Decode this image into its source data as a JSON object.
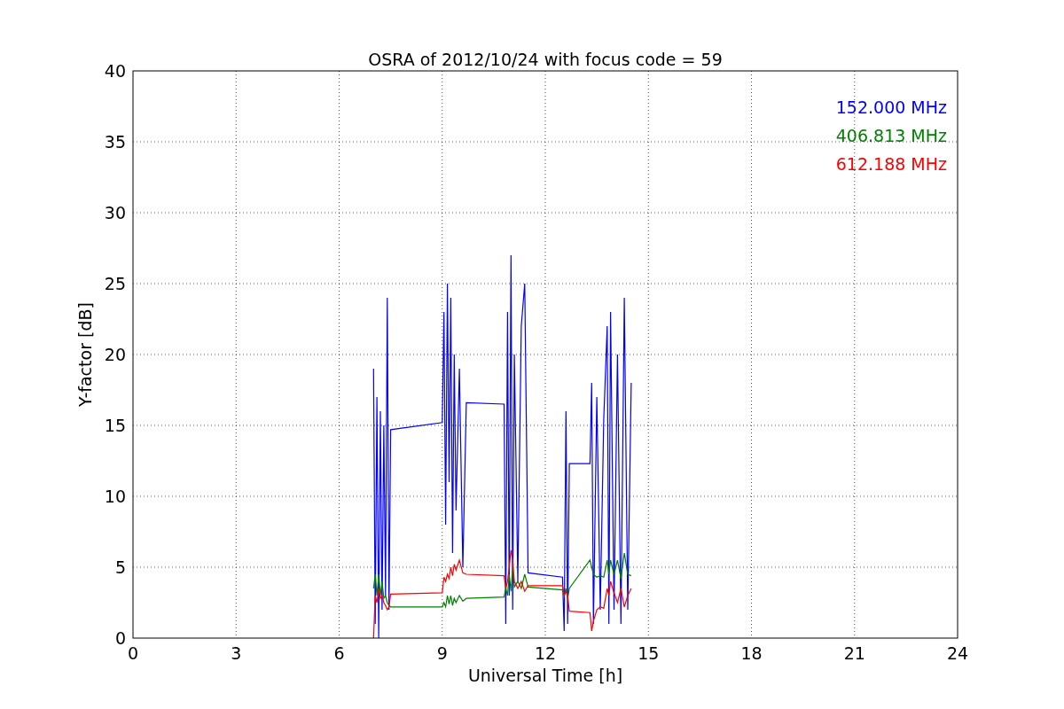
{
  "figure": {
    "chart_data": {
      "type": "line",
      "title": "OSRA of 2012/10/24 with focus code = 59",
      "xlabel": "Universal Time [h]",
      "ylabel": "Y-factor [dB]",
      "x": [
        7.0,
        7.05,
        7.1,
        7.15,
        7.2,
        7.25,
        7.3,
        7.35,
        7.4,
        7.45,
        7.5,
        9.0,
        9.05,
        9.1,
        9.15,
        9.2,
        9.25,
        9.3,
        9.35,
        9.4,
        9.5,
        9.6,
        9.7,
        10.8,
        10.85,
        10.9,
        10.95,
        11.0,
        11.05,
        11.1,
        11.2,
        11.3,
        11.4,
        11.5,
        12.5,
        12.55,
        12.6,
        12.65,
        12.7,
        13.3,
        13.35,
        13.4,
        13.5,
        13.6,
        13.7,
        13.8,
        13.85,
        13.9,
        14.0,
        14.1,
        14.2,
        14.3,
        14.4,
        14.5
      ],
      "series": [
        {
          "name": "152.000 MHz",
          "color": "#0000ff",
          "values": [
            19,
            1,
            17,
            0,
            16,
            2,
            15,
            3,
            24,
            2,
            14.7,
            15.2,
            23,
            8,
            25,
            11,
            24,
            6,
            20,
            9,
            19,
            5,
            16.6,
            16.5,
            1,
            23,
            3,
            27,
            2,
            20,
            4,
            22,
            25,
            4.6,
            4.3,
            0.5,
            16,
            1,
            12.3,
            12.3,
            18,
            1,
            17,
            2,
            15.4,
            22,
            1,
            23,
            2,
            20,
            1,
            24,
            2,
            18
          ]
        },
        {
          "name": "406.813 MHz",
          "color": "#008000",
          "values": [
            3.5,
            4.5,
            3,
            4.5,
            3,
            4,
            2.8,
            3,
            2.5,
            2.3,
            2.2,
            2.2,
            2.5,
            2.2,
            3,
            2.4,
            3,
            2.3,
            2.8,
            2.5,
            3,
            2.6,
            2.8,
            2.9,
            3.5,
            3,
            4.5,
            3.3,
            5,
            3.6,
            4,
            3.5,
            4.5,
            3.6,
            3.4,
            3,
            3.5,
            2.8,
            3.5,
            5.5,
            5,
            4.5,
            4.3,
            4.4,
            4.3,
            5.5,
            4.5,
            5.5,
            4.5,
            5.5,
            4.2,
            6,
            4.5,
            4.4
          ]
        },
        {
          "name": "612.188 MHz",
          "color": "#ff0000",
          "values": [
            0,
            3,
            2.5,
            3.5,
            2.8,
            3,
            2.5,
            2.3,
            2,
            2.2,
            3.1,
            3.2,
            4.3,
            4,
            4.5,
            4.2,
            5,
            4.4,
            5.2,
            4.8,
            5.5,
            4.6,
            4.5,
            4.4,
            3.5,
            4,
            5,
            6.2,
            5.5,
            4,
            3.5,
            4,
            3.3,
            3.7,
            3.7,
            3,
            3.3,
            3,
            1.9,
            1.8,
            0.5,
            1.2,
            2,
            2.2,
            2.1,
            3.5,
            3,
            4,
            3.2,
            2.5,
            3.5,
            2.2,
            3,
            3.5
          ]
        }
      ],
      "grid": true,
      "xlim": [
        0,
        24
      ],
      "ylim": [
        0,
        40
      ],
      "xticks": [
        0,
        3,
        6,
        9,
        12,
        15,
        18,
        21,
        24
      ],
      "yticks": [
        0,
        5,
        10,
        15,
        20,
        25,
        30,
        35,
        40
      ]
    }
  }
}
